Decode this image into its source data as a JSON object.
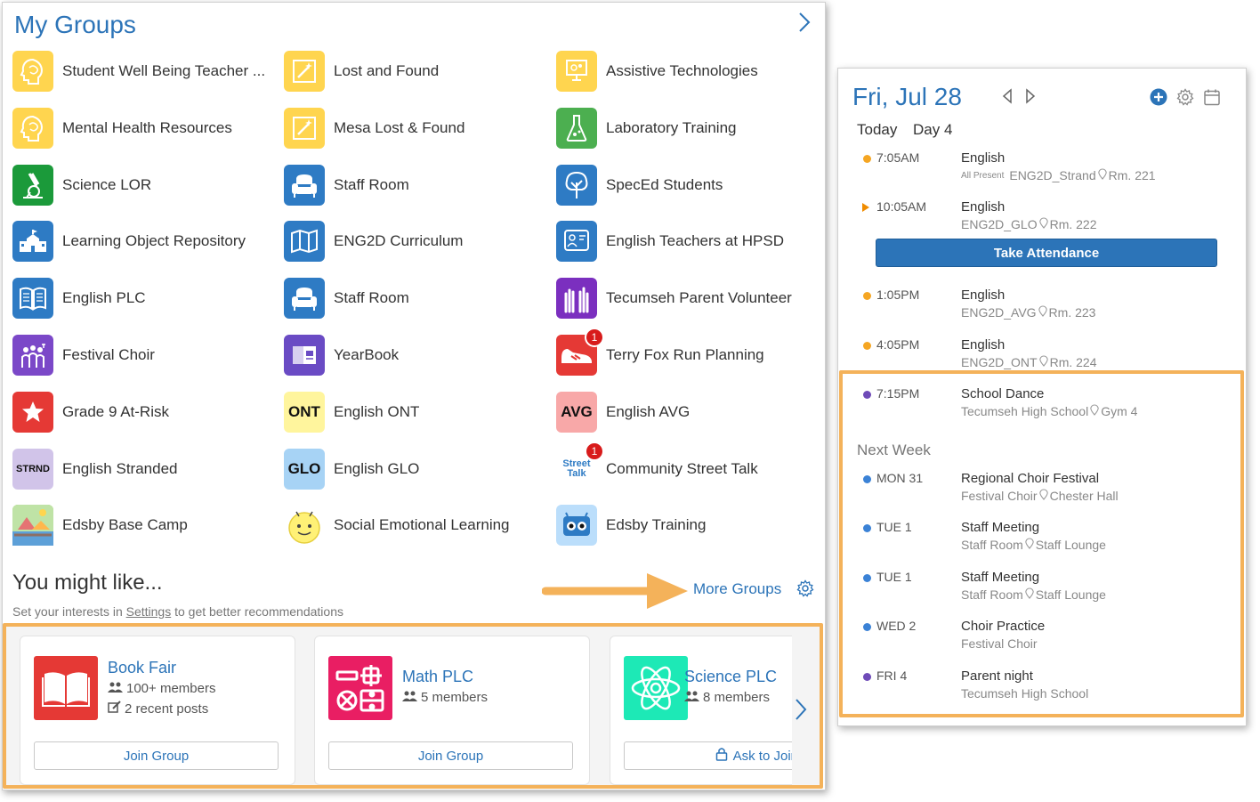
{
  "groups_panel": {
    "title": "My Groups",
    "items": [
      {
        "label": "Student Well Being Teacher ...",
        "icon": "head-icon",
        "color": "#ffd54f"
      },
      {
        "label": "Lost and Found",
        "icon": "wand-icon",
        "color": "#ffd54f"
      },
      {
        "label": "Assistive Technologies",
        "icon": "computer-icon",
        "color": "#ffd54f"
      },
      {
        "label": "Mental Health Resources",
        "icon": "head-icon",
        "color": "#ffd54f"
      },
      {
        "label": "Mesa Lost & Found",
        "icon": "wand-icon",
        "color": "#ffd54f"
      },
      {
        "label": "Laboratory Training",
        "icon": "flask-icon",
        "color": "#4caf50"
      },
      {
        "label": "Science LOR",
        "icon": "microscope-icon",
        "color": "#1b9a3a"
      },
      {
        "label": "Staff Room",
        "icon": "armchair-icon",
        "color": "#2e7bc4"
      },
      {
        "label": "SpecEd Students",
        "icon": "tree-icon",
        "color": "#2e7bc4"
      },
      {
        "label": "Learning Object Repository",
        "icon": "school-icon",
        "color": "#2e7bc4"
      },
      {
        "label": "ENG2D Curriculum",
        "icon": "map-icon",
        "color": "#2e7bc4"
      },
      {
        "label": "English Teachers at HPSD",
        "icon": "chat-icon",
        "color": "#2e7bc4"
      },
      {
        "label": "English PLC",
        "icon": "book-icon",
        "color": "#2e7bc4"
      },
      {
        "label": "Staff Room",
        "icon": "armchair-icon",
        "color": "#2e7bc4"
      },
      {
        "label": "Tecumseh Parent Volunteer",
        "icon": "hands-icon",
        "color": "#7b2fbf"
      },
      {
        "label": "Festival Choir",
        "icon": "choir-icon",
        "color": "#7b48c8"
      },
      {
        "label": "YearBook",
        "icon": "yearbook-icon",
        "color": "#6a4bc4"
      },
      {
        "label": "Terry Fox Run Planning",
        "icon": "shoe-icon",
        "color": "#e53935",
        "badge": "1"
      },
      {
        "label": "Grade 9 At-Risk",
        "icon": "star-icon",
        "color": "#e53935"
      },
      {
        "label": "English ONT",
        "icon": "ont-icon",
        "color": "#fff59d",
        "icon_text": "ONT"
      },
      {
        "label": "English AVG",
        "icon": "avg-icon",
        "color": "#f8a8a8",
        "icon_text": "AVG"
      },
      {
        "label": "English Stranded",
        "icon": "strnd-icon",
        "color": "#d1c4e9",
        "icon_text": "STRND"
      },
      {
        "label": "English GLO",
        "icon": "glo-icon",
        "color": "#a7d3f5",
        "icon_text": "GLO"
      },
      {
        "label": "Community Street Talk",
        "icon": "street-talk-icon",
        "color": "#ffffff",
        "icon_text": "Street Talk",
        "badge": "1"
      },
      {
        "label": "Edsby Base Camp",
        "icon": "camp-icon",
        "color": "#8bc34a"
      },
      {
        "label": "Social Emotional Learning",
        "icon": "smiley-icon",
        "color": "#ffffff"
      },
      {
        "label": "Edsby Training",
        "icon": "robot-icon",
        "color": "#bbdefb"
      }
    ]
  },
  "you_might_like": {
    "title": "You might like...",
    "subtitle_before": "Set your interests in ",
    "subtitle_link": "Settings",
    "subtitle_after": " to get better recommendations",
    "more_groups": "More Groups",
    "cards": [
      {
        "title": "Book Fair",
        "members": "100+ members",
        "posts": "2 recent posts",
        "button": "Join Group",
        "color": "#e53935",
        "icon": "open-book-icon"
      },
      {
        "title": "Math PLC",
        "members": "5 members",
        "posts": "",
        "button": "Join Group",
        "color": "#e91e63",
        "icon": "math-icon"
      },
      {
        "title": "Science PLC",
        "members": "8 members",
        "posts": "",
        "button": "Ask to Join",
        "color": "#1de9b6",
        "icon": "atom-icon"
      }
    ]
  },
  "calendar": {
    "date": "Fri, Jul 28",
    "today_label": "Today",
    "day_label": "Day 4",
    "take_attendance": "Take Attendance",
    "next_week_label": "Next Week",
    "today_events": [
      {
        "time": "7:05AM",
        "title": "English",
        "present": "All Present",
        "section": "ENG2D_Strand",
        "room": "Rm. 221",
        "color": "#f5a623",
        "marker": "dot"
      },
      {
        "time": "10:05AM",
        "title": "English",
        "present": "",
        "section": "ENG2D_GLO",
        "room": "Rm. 222",
        "color": "#f08c00",
        "marker": "triangle"
      },
      {
        "time": "1:05PM",
        "title": "English",
        "present": "",
        "section": "ENG2D_AVG",
        "room": "Rm. 223",
        "color": "#f5a623",
        "marker": "dot"
      },
      {
        "time": "4:05PM",
        "title": "English",
        "present": "",
        "section": "ENG2D_ONT",
        "room": "Rm. 224",
        "color": "#f5a623",
        "marker": "dot"
      },
      {
        "time": "7:15PM",
        "title": "School Dance",
        "present": "",
        "section": "Tecumseh High School",
        "room": "Gym 4",
        "color": "#6f4bb8",
        "marker": "dot"
      }
    ],
    "next_week_events": [
      {
        "time": "MON 31",
        "title": "Regional Choir Festival",
        "section": "Festival Choir",
        "room": "Chester Hall",
        "color": "#3b82d6"
      },
      {
        "time": "TUE 1",
        "title": "Staff Meeting",
        "section": "Staff Room",
        "room": "Staff Lounge",
        "color": "#3b82d6"
      },
      {
        "time": "TUE 1",
        "title": "Staff Meeting",
        "section": "Staff Room",
        "room": "Staff Lounge",
        "color": "#3b82d6"
      },
      {
        "time": "WED 2",
        "title": "Choir Practice",
        "section": "Festival Choir",
        "room": "",
        "color": "#3b82d6"
      },
      {
        "time": "FRI 4",
        "title": "Parent night",
        "section": "Tecumseh High School",
        "room": "",
        "color": "#6f4bb8"
      }
    ]
  },
  "colors": {
    "accent": "#2c74b8",
    "highlight": "#f4b25a"
  }
}
